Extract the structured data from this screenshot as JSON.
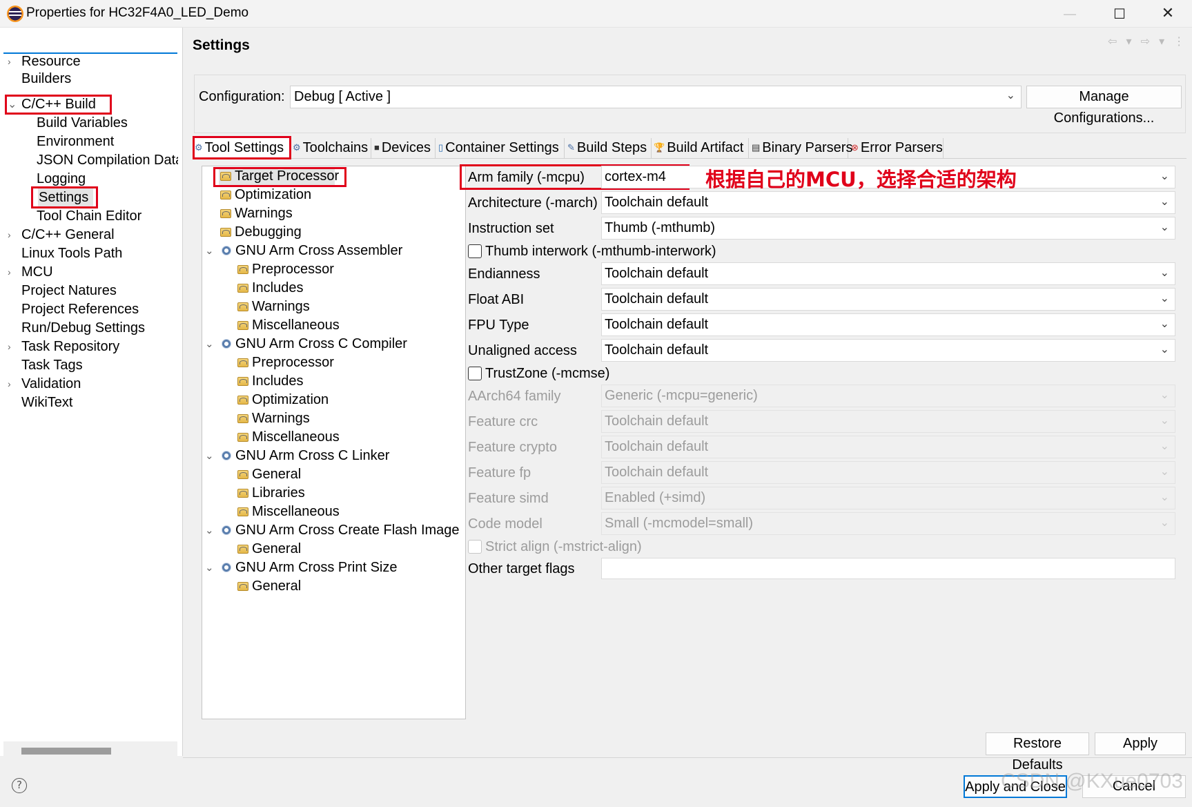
{
  "window": {
    "title": "Properties for HC32F4A0_LED_Demo",
    "min_glyph": "—",
    "max_glyph": "☐",
    "close_glyph": "✕"
  },
  "left_nav": {
    "filter_value": "",
    "items": [
      {
        "label": "Resource",
        "expander": "›"
      },
      {
        "label": "Builders"
      },
      {
        "label": "C/C++ Build",
        "expander": "⌄"
      },
      {
        "label": "Build Variables"
      },
      {
        "label": "Environment"
      },
      {
        "label": "JSON Compilation Data"
      },
      {
        "label": "Logging"
      },
      {
        "label": "Settings"
      },
      {
        "label": "Tool Chain Editor"
      },
      {
        "label": "C/C++ General",
        "expander": "›"
      },
      {
        "label": "Linux Tools Path"
      },
      {
        "label": "MCU",
        "expander": "›"
      },
      {
        "label": "Project Natures"
      },
      {
        "label": "Project References"
      },
      {
        "label": "Run/Debug Settings"
      },
      {
        "label": "Task Repository",
        "expander": "›"
      },
      {
        "label": "Task Tags"
      },
      {
        "label": "Validation",
        "expander": "›"
      },
      {
        "label": "WikiText"
      }
    ]
  },
  "header": {
    "title": "Settings",
    "nav_arrows": "⇦ ▾ ⇨ ▾ ⋮"
  },
  "configuration": {
    "label": "Configuration:",
    "value": "Debug  [ Active ]",
    "manage_label": "Manage Configurations..."
  },
  "tabs": [
    {
      "label": "Tool Settings",
      "icon": "⚙"
    },
    {
      "label": "Toolchains",
      "icon": "⚙"
    },
    {
      "label": "Devices",
      "icon": "■"
    },
    {
      "label": "Container Settings",
      "icon": "▯"
    },
    {
      "label": "Build Steps",
      "icon": "✎"
    },
    {
      "label": "Build Artifact",
      "icon": "🏆"
    },
    {
      "label": "Binary Parsers",
      "icon": "▤"
    },
    {
      "label": "Error Parsers",
      "icon": "⊗"
    }
  ],
  "tool_tree": [
    {
      "label": "Target Processor"
    },
    {
      "label": "Optimization"
    },
    {
      "label": "Warnings"
    },
    {
      "label": "Debugging"
    },
    {
      "label": "GNU Arm Cross Assembler"
    },
    {
      "label": "Preprocessor"
    },
    {
      "label": "Includes"
    },
    {
      "label": "Warnings"
    },
    {
      "label": "Miscellaneous"
    },
    {
      "label": "GNU Arm Cross C Compiler"
    },
    {
      "label": "Preprocessor"
    },
    {
      "label": "Includes"
    },
    {
      "label": "Optimization"
    },
    {
      "label": "Warnings"
    },
    {
      "label": "Miscellaneous"
    },
    {
      "label": "GNU Arm Cross C Linker"
    },
    {
      "label": "General"
    },
    {
      "label": "Libraries"
    },
    {
      "label": "Miscellaneous"
    },
    {
      "label": "GNU Arm Cross Create Flash Image"
    },
    {
      "label": "General"
    },
    {
      "label": "GNU Arm Cross Print Size"
    },
    {
      "label": "General"
    }
  ],
  "tree_expander": "⌄",
  "properties": {
    "arm_family": {
      "label": "Arm family (-mcpu)",
      "value": "cortex-m4"
    },
    "architecture": {
      "label": "Architecture (-march)",
      "value": "Toolchain default"
    },
    "instruction_set": {
      "label": "Instruction set",
      "value": "Thumb (-mthumb)"
    },
    "thumb_interwork": {
      "label": "Thumb interwork (-mthumb-interwork)",
      "checked": false
    },
    "endianness": {
      "label": "Endianness",
      "value": "Toolchain default"
    },
    "float_abi": {
      "label": "Float ABI",
      "value": "Toolchain default"
    },
    "fpu_type": {
      "label": "FPU Type",
      "value": "Toolchain default"
    },
    "unaligned_access": {
      "label": "Unaligned access",
      "value": "Toolchain default"
    },
    "trustzone": {
      "label": "TrustZone (-mcmse)",
      "checked": false
    },
    "aarch64_family": {
      "label": "AArch64 family",
      "value": "Generic (-mcpu=generic)"
    },
    "feature_crc": {
      "label": "Feature crc",
      "value": "Toolchain default"
    },
    "feature_crypto": {
      "label": "Feature crypto",
      "value": "Toolchain default"
    },
    "feature_fp": {
      "label": "Feature fp",
      "value": "Toolchain default"
    },
    "feature_simd": {
      "label": "Feature simd",
      "value": "Enabled (+simd)"
    },
    "code_model": {
      "label": "Code model",
      "value": "Small (-mcmodel=small)"
    },
    "strict_align": {
      "label": "Strict align (-mstrict-align)",
      "checked": false
    },
    "other_flags": {
      "label": "Other target flags",
      "value": ""
    }
  },
  "caret_glyph": "⌄",
  "annotation": "根据自己的MCU，选择合适的架构",
  "buttons": {
    "restore_defaults": "Restore Defaults",
    "apply": "Apply",
    "apply_and_close": "Apply and Close",
    "cancel": "Cancel"
  },
  "help_glyph": "?",
  "watermark": "CSDN @KXue0703",
  "colors": {
    "highlight": "#e0001a",
    "focus": "#0078d7",
    "selection": "#e4e4e4"
  }
}
